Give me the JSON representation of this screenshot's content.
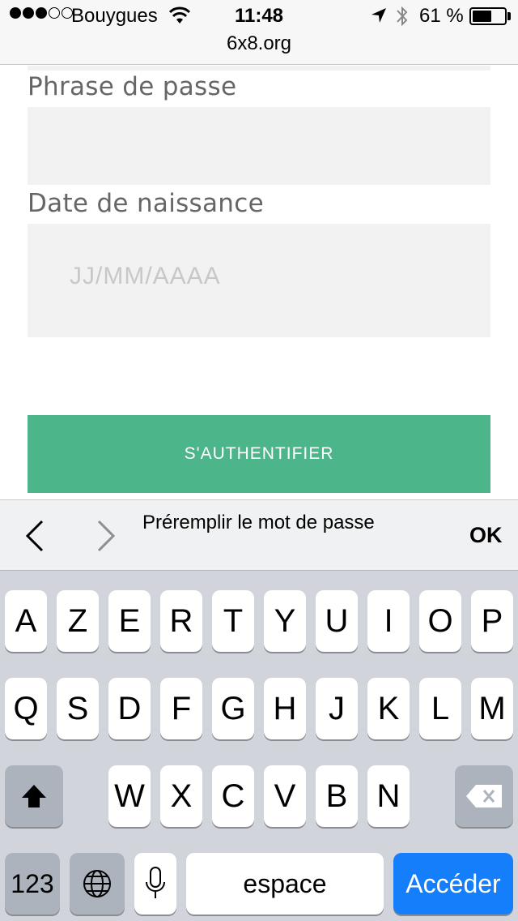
{
  "status": {
    "carrier": "Bouygues",
    "time": "11:48",
    "battery_pct": "61 %",
    "battery_level": 0.61,
    "url": "6x8.org",
    "icons": [
      "signal-dots",
      "wifi-icon",
      "location-arrow-icon",
      "bluetooth-icon",
      "battery-icon"
    ]
  },
  "form": {
    "passphrase_label": "Phrase de passe",
    "passphrase_value": "",
    "birthdate_label": "Date de naissance",
    "birthdate_placeholder": "JJ/MM/AAAA",
    "submit_label": "S'AUTHENTIFIER",
    "submit_color": "#4cb58a"
  },
  "assistant": {
    "prefill_text": "Préremplir le mot de passe",
    "ok_label": "OK"
  },
  "keyboard": {
    "row1": [
      "A",
      "Z",
      "E",
      "R",
      "T",
      "Y",
      "U",
      "I",
      "O",
      "P"
    ],
    "row2": [
      "Q",
      "S",
      "D",
      "F",
      "G",
      "H",
      "J",
      "K",
      "L",
      "M"
    ],
    "row3": [
      "W",
      "X",
      "C",
      "V",
      "B",
      "N"
    ],
    "numbers_label": "123",
    "space_label": "espace",
    "go_label": "Accéder",
    "go_color": "#147efb"
  }
}
